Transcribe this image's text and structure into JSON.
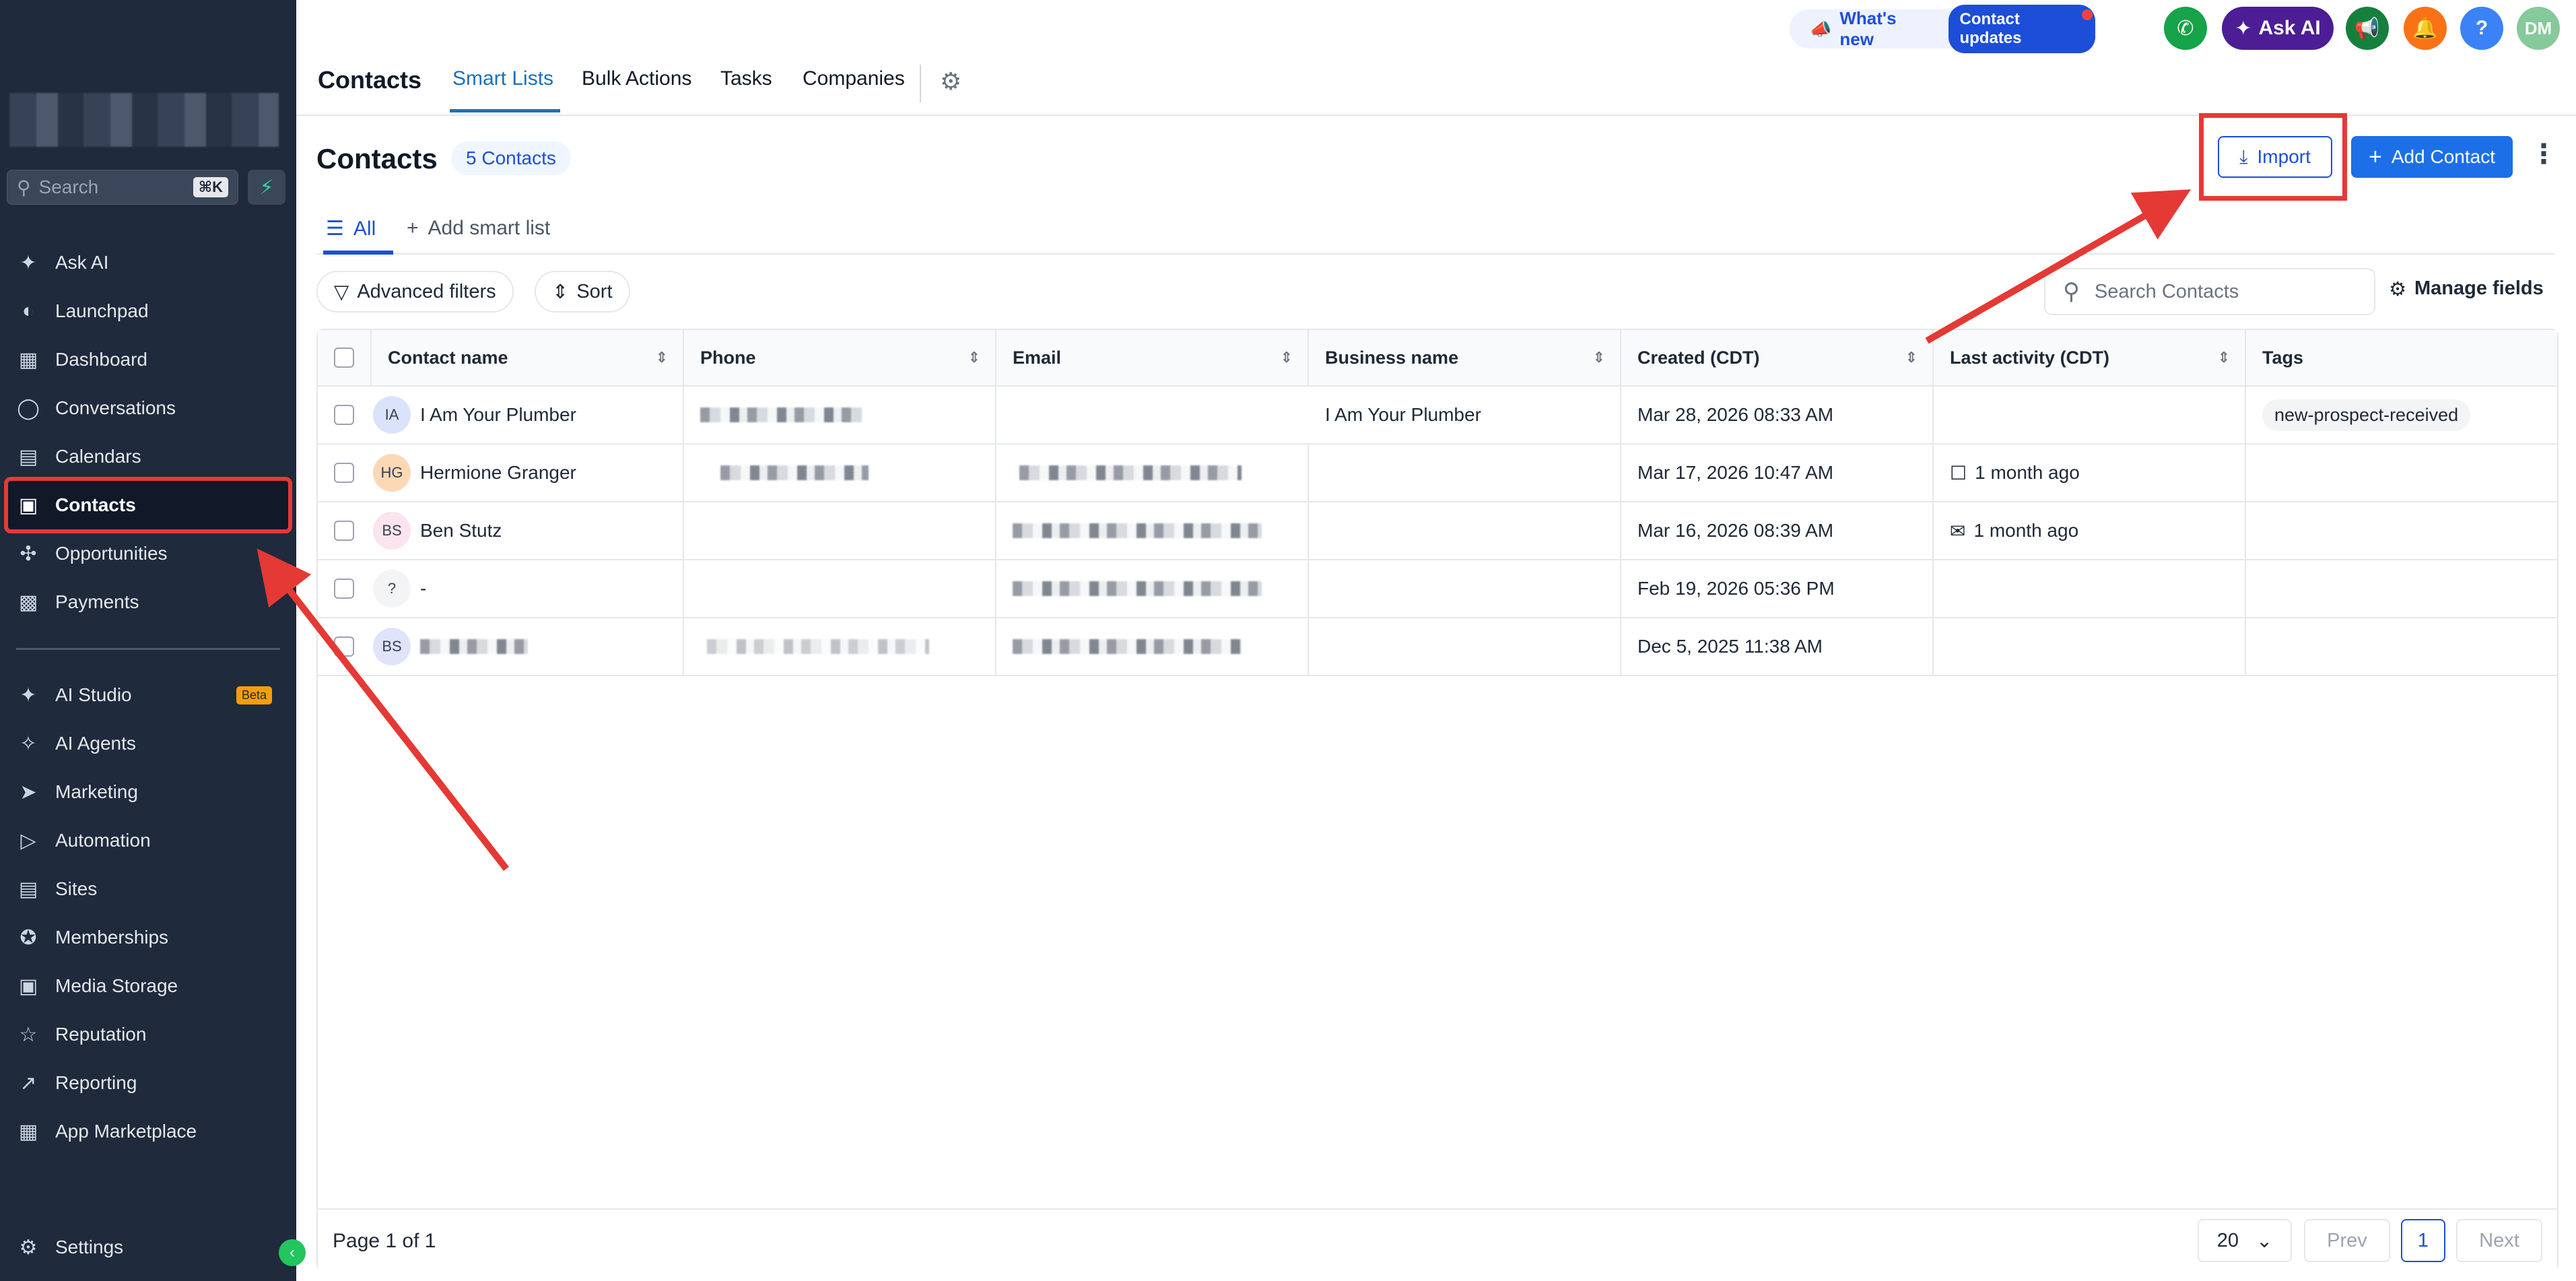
{
  "sidebar": {
    "search_placeholder": "Search",
    "search_shortcut": "⌘K",
    "items_top": [
      {
        "label": "Ask AI",
        "icon": "sparkle-icon"
      },
      {
        "label": "Launchpad",
        "icon": "rocket-icon"
      },
      {
        "label": "Dashboard",
        "icon": "grid-icon"
      },
      {
        "label": "Conversations",
        "icon": "chat-icon"
      },
      {
        "label": "Calendars",
        "icon": "calendar-icon"
      },
      {
        "label": "Contacts",
        "icon": "contact-card-icon"
      },
      {
        "label": "Opportunities",
        "icon": "network-icon"
      },
      {
        "label": "Payments",
        "icon": "receipt-icon"
      }
    ],
    "items_bottom": [
      {
        "label": "AI Studio",
        "icon": "sparkle-icon",
        "badge": "Beta"
      },
      {
        "label": "AI Agents",
        "icon": "agent-icon"
      },
      {
        "label": "Marketing",
        "icon": "send-icon"
      },
      {
        "label": "Automation",
        "icon": "play-circle-icon"
      },
      {
        "label": "Sites",
        "icon": "layout-icon"
      },
      {
        "label": "Memberships",
        "icon": "badge-icon"
      },
      {
        "label": "Media Storage",
        "icon": "image-icon"
      },
      {
        "label": "Reputation",
        "icon": "star-icon"
      },
      {
        "label": "Reporting",
        "icon": "trend-icon"
      },
      {
        "label": "App Marketplace",
        "icon": "apps-icon"
      }
    ],
    "settings_label": "Settings"
  },
  "topbar": {
    "module_title": "Contacts",
    "tabs": [
      "Smart Lists",
      "Bulk Actions",
      "Tasks",
      "Companies"
    ],
    "whats_new": "What's new",
    "contact_updates": "Contact updates",
    "ask_ai": "Ask AI",
    "user_initials": "DM",
    "help": "?"
  },
  "main": {
    "title": "Contacts",
    "count_badge": "5 Contacts",
    "import_label": "Import",
    "add_contact_label": "Add Contact",
    "list_tab_all": "All",
    "add_smart_list": "Add smart list",
    "advanced_filters": "Advanced filters",
    "sort": "Sort",
    "search_placeholder": "Search Contacts",
    "manage_fields": "Manage fields"
  },
  "table": {
    "columns": [
      "Contact name",
      "Phone",
      "Email",
      "Business name",
      "Created (CDT)",
      "Last activity (CDT)",
      "Tags"
    ],
    "rows": [
      {
        "initials": "IA",
        "avatar_color": "#dbe3fb",
        "name": "I Am Your Plumber",
        "business": "I Am Your Plumber",
        "created": "Mar 28, 2026 08:33 AM",
        "activity": "",
        "activity_icon": "",
        "tag": "new-prospect-received"
      },
      {
        "initials": "HG",
        "avatar_color": "#fdd8b5",
        "name": "Hermione Granger",
        "business": "",
        "created": "Mar 17, 2026 10:47 AM",
        "activity": "1 month ago",
        "activity_icon": "chat-icon",
        "tag": ""
      },
      {
        "initials": "BS",
        "avatar_color": "#fbe4ee",
        "name": "Ben Stutz",
        "business": "",
        "created": "Mar 16, 2026 08:39 AM",
        "activity": "1 month ago",
        "activity_icon": "mail-icon",
        "tag": ""
      },
      {
        "initials": "?",
        "avatar_color": "#f3f4f6",
        "name": "-",
        "business": "",
        "created": "Feb 19, 2026 05:36 PM",
        "activity": "",
        "activity_icon": "",
        "tag": ""
      },
      {
        "initials": "BS",
        "avatar_color": "#e0e4fb",
        "name": "",
        "business": "",
        "created": "Dec 5, 2025 11:38 AM",
        "activity": "",
        "activity_icon": "",
        "tag": ""
      }
    ]
  },
  "pager": {
    "page_label": "Page 1 of 1",
    "page_size": "20",
    "prev": "Prev",
    "current": "1",
    "next": "Next"
  },
  "colors": {
    "sidebar_bg": "#1f2a3c",
    "accent": "#1d6fe8",
    "annotation": "#e53935",
    "ask_ai": "#4c1d95"
  }
}
